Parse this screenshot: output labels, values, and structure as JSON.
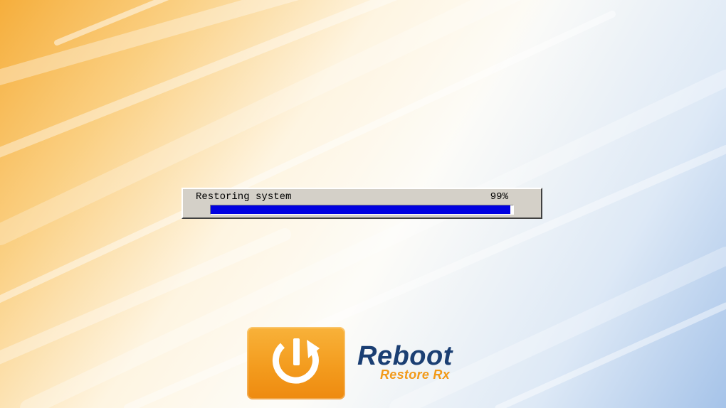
{
  "dialog": {
    "label": "Restoring system",
    "percent_text": "99%",
    "progress": 0.99
  },
  "brand": {
    "name": "Reboot",
    "product": "Restore Rx",
    "logo_icon": "power-restore-icon"
  },
  "colors": {
    "progress_fill": "#0000e0",
    "dialog_bg": "#d4d0c8",
    "brand_blue": "#1b3f73",
    "brand_orange": "#f29a1a",
    "logo_tile": "#f39a1c"
  }
}
